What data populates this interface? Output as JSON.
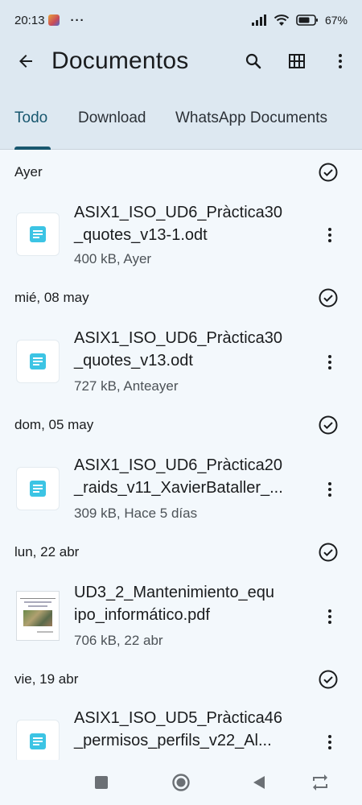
{
  "status_bar": {
    "time": "20:13",
    "dots": "···",
    "battery": "67"
  },
  "app_bar": {
    "title": "Documentos",
    "back_icon": "arrow-back-icon",
    "search_icon": "search-icon",
    "grid_icon": "grid-view-icon",
    "more_icon": "more-vert-icon"
  },
  "tabs": [
    {
      "label": "Todo",
      "active": true
    },
    {
      "label": "Download",
      "active": false
    },
    {
      "label": "WhatsApp Documents",
      "active": false
    }
  ],
  "groups": [
    {
      "label": "Ayer",
      "file": {
        "name_line1": "ASIX1_ISO_UD6_Pràctica30",
        "name_line2": "_quotes_v13-1.odt",
        "meta": "400 kB, Ayer",
        "type": "document"
      }
    },
    {
      "label": "mié, 08 may",
      "file": {
        "name_line1": "ASIX1_ISO_UD6_Pràctica30",
        "name_line2": "_quotes_v13.odt",
        "meta": "727 kB, Anteayer",
        "type": "document"
      }
    },
    {
      "label": "dom, 05 may",
      "file": {
        "name_line1": "ASIX1_ISO_UD6_Pràctica20",
        "name_line2": "_raids_v11_XavierBataller_...",
        "meta": "309 kB, Hace 5 días",
        "type": "document"
      }
    },
    {
      "label": "lun, 22 abr",
      "file": {
        "name_line1": "UD3_2_Mantenimiento_equ",
        "name_line2": "ipo_informático.pdf",
        "meta": "706 kB, 22 abr",
        "type": "pdf"
      }
    },
    {
      "label": "vie, 19 abr",
      "file": {
        "name_line1": "ASIX1_ISO_UD5_Pràctica46",
        "name_line2": "_permisos_perfils_v22_Al...",
        "meta": "",
        "type": "document"
      }
    }
  ],
  "colors": {
    "accent": "#18576f",
    "doc_icon": "#3cc4e4",
    "header_bg": "#dde8f1",
    "page_bg": "#f3f8fc"
  }
}
